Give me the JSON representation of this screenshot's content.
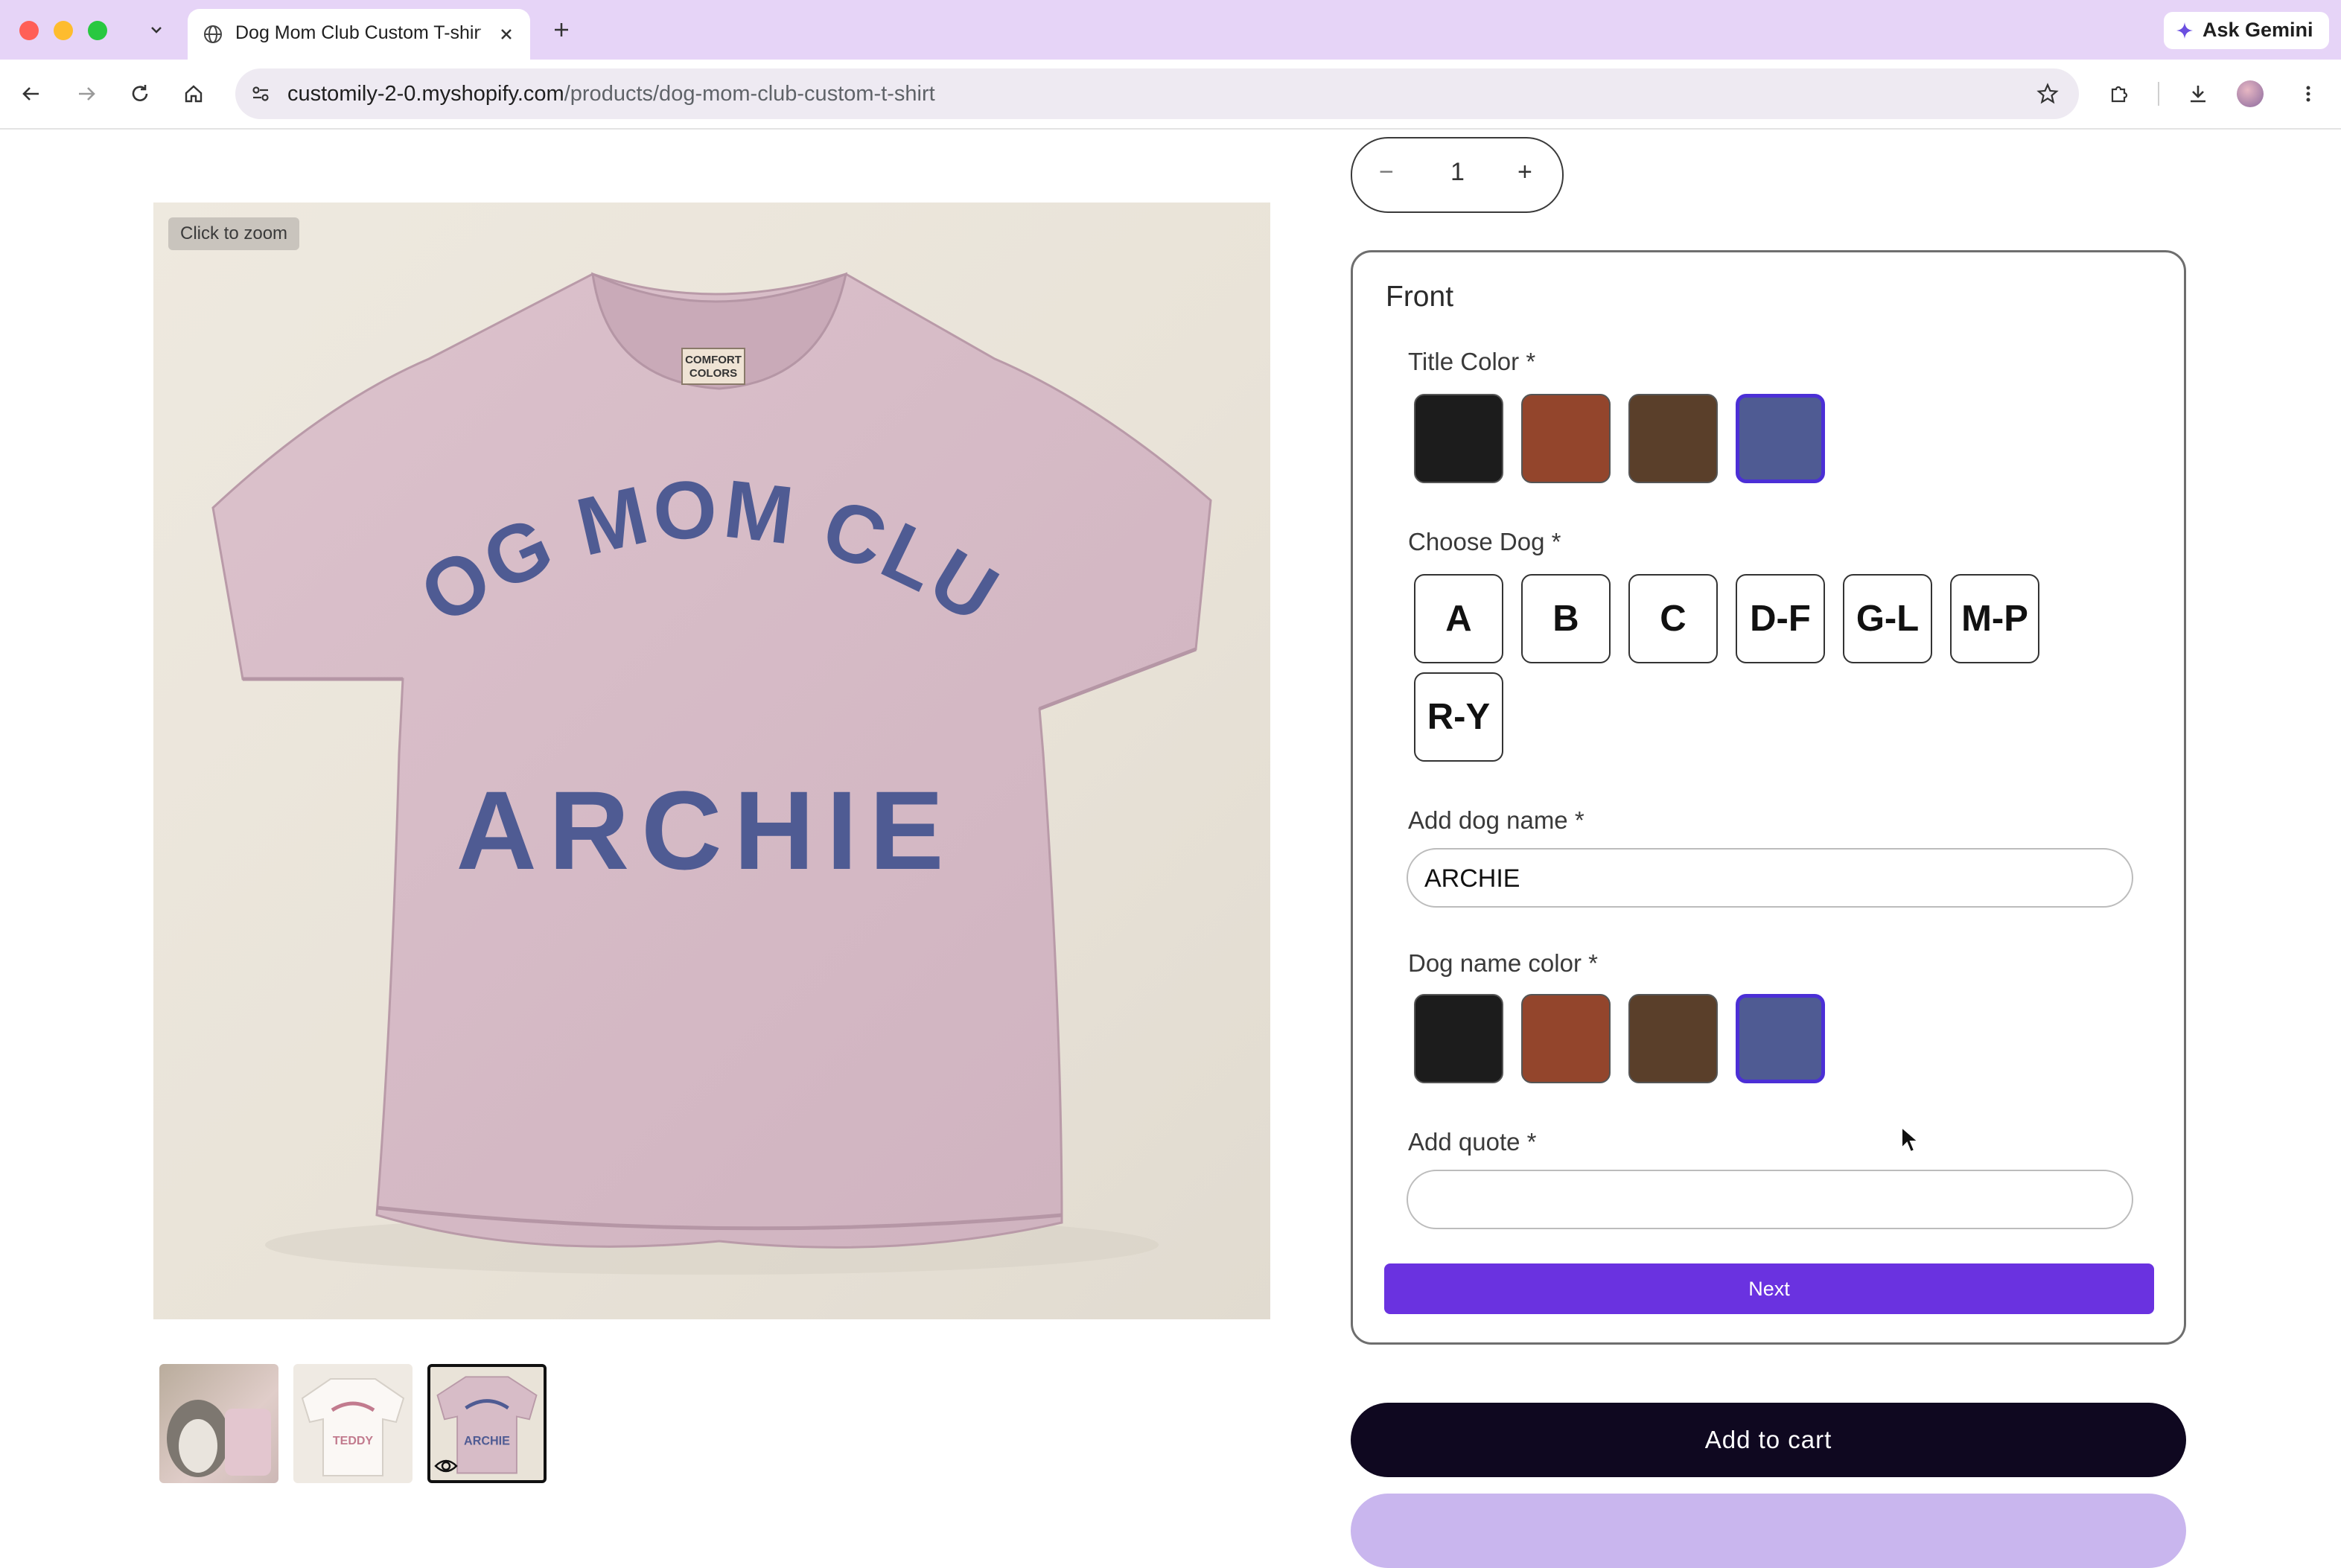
{
  "browser": {
    "tab_title": "Dog Mom Club Custom T-shirt",
    "url_domain": "customily-2-0.myshopify.com",
    "url_path": "/products/dog-mom-club-custom-t-shirt",
    "gemini_label": "Ask Gemini",
    "tab_colors": {
      "close": "#ff5f57",
      "minimize": "#febc2e",
      "maximize": "#28c840"
    }
  },
  "product": {
    "zoom_label": "Click to zoom",
    "shirt_title_text": "DOG MOM CLUB",
    "shirt_name_text": "ARCHIE",
    "shirt_label_text": "COMFORT COLORS",
    "thumbnails": [
      {
        "name": "thumb-dog-photo",
        "selected": false
      },
      {
        "name": "thumb-white-shirt",
        "selected": false,
        "text": "TEDDY"
      },
      {
        "name": "thumb-pink-shirt",
        "selected": true,
        "text": "ARCHIE"
      }
    ]
  },
  "quantity": {
    "value": "1",
    "minus": "−",
    "plus": "+"
  },
  "customizer": {
    "section_title": "Front",
    "title_color_label": "Title Color *",
    "choose_dog_label": "Choose Dog *",
    "dog_options": [
      "A",
      "B",
      "C",
      "D-F",
      "G-L",
      "M-P",
      "R-Y"
    ],
    "dog_name_label": "Add dog name *",
    "dog_name_value": "ARCHIE",
    "dog_name_color_label": "Dog name color *",
    "quote_label": "Add quote *",
    "quote_value": "",
    "next_label": "Next",
    "colors": [
      "#1c1c1c",
      "#93452c",
      "#5a3f2a",
      "#4f5b93"
    ],
    "selected_color_index": 3
  },
  "cart": {
    "add_to_cart_label": "Add to cart"
  }
}
